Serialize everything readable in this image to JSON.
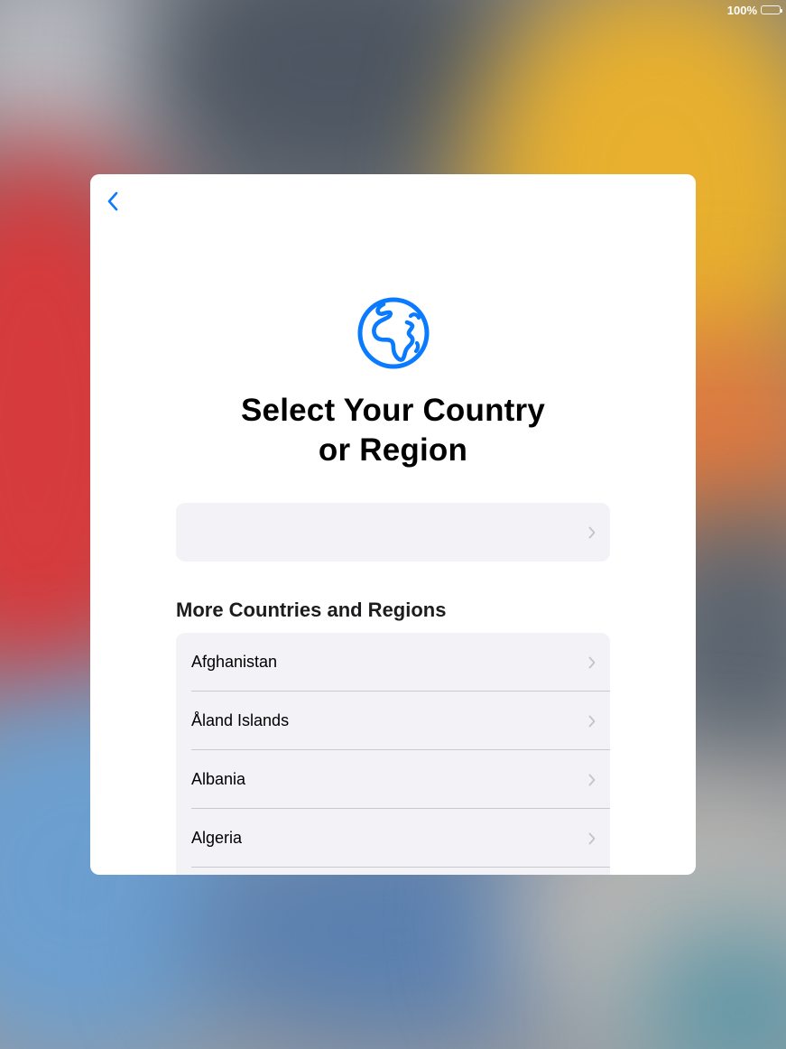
{
  "status_bar": {
    "battery_text": "100%",
    "battery_level": 1.0
  },
  "sheet": {
    "back_icon": "chevron-left-icon",
    "globe_icon": "globe-africa-icon",
    "title_line1": "Select Your Country",
    "title_line2": "or Region",
    "suggested_row": {
      "label": ""
    },
    "section_header": "More Countries and Regions",
    "countries": [
      {
        "label": "Afghanistan"
      },
      {
        "label": "Åland Islands"
      },
      {
        "label": "Albania"
      },
      {
        "label": "Algeria"
      },
      {
        "label": ""
      }
    ]
  },
  "colors": {
    "accent": "#0a7aff",
    "list_background": "#f2f2f7",
    "chevron": "#c4c4c7"
  }
}
